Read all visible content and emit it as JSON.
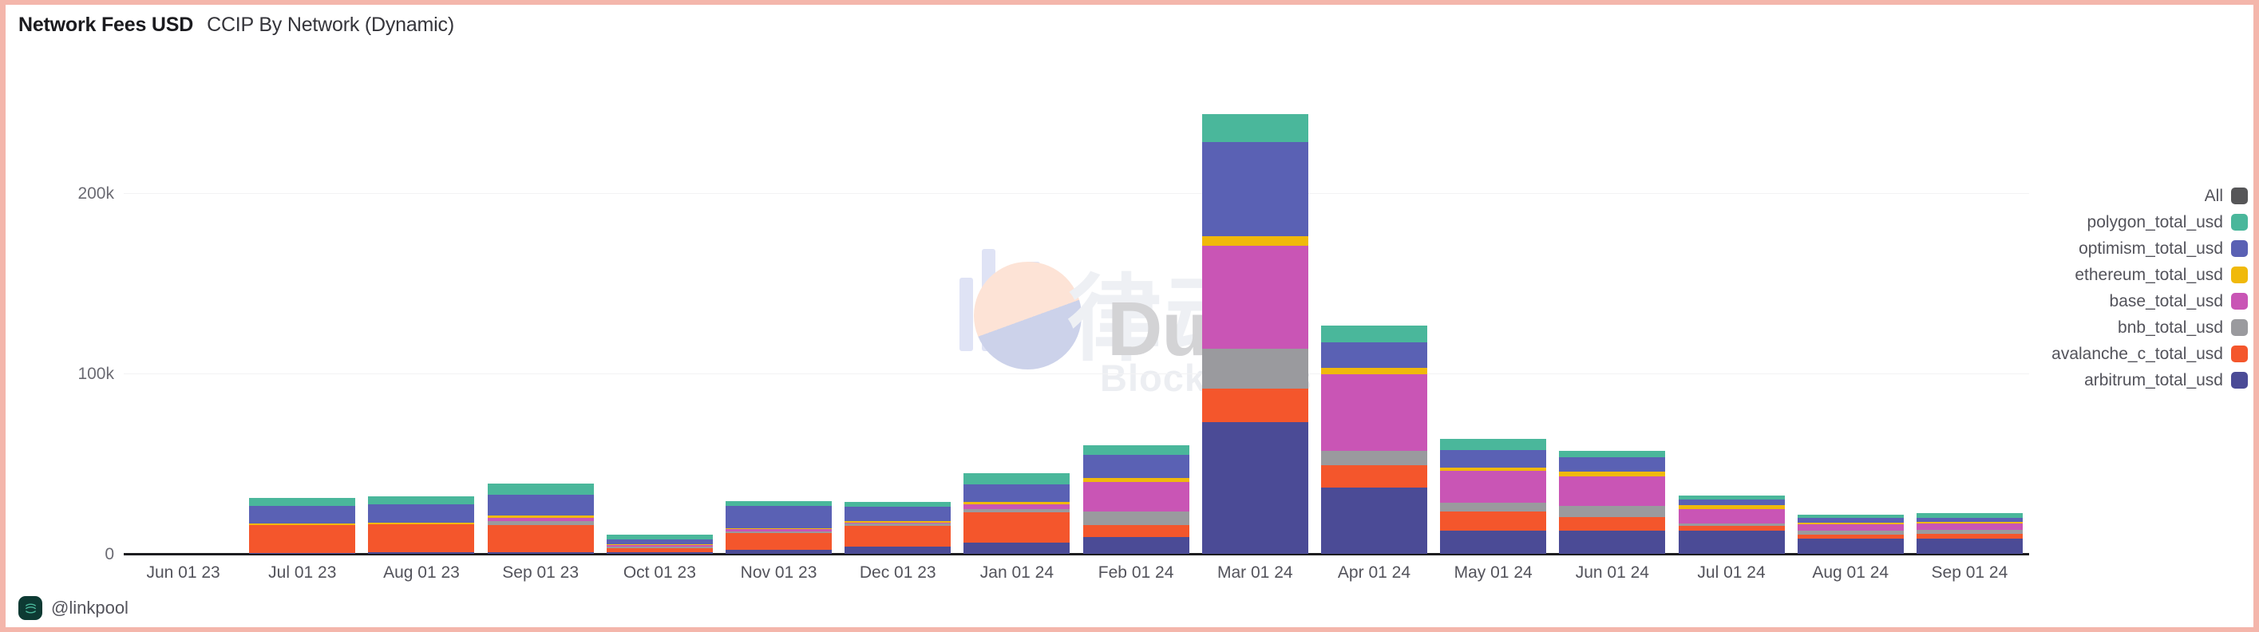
{
  "header": {
    "title": "Network Fees USD",
    "subtitle": "CCIP By Network (Dynamic)"
  },
  "footer": {
    "handle": "@linkpool",
    "icon": "linkpool-logo-icon"
  },
  "watermark": {
    "brand": "Dune",
    "cn_text": "律动",
    "sub_text": "BlockBeats"
  },
  "legend": {
    "position": "right",
    "items": [
      {
        "label": "All",
        "color": "#565658"
      },
      {
        "label": "polygon_total_usd",
        "color": "#4ab79b"
      },
      {
        "label": "optimism_total_usd",
        "color": "#5a61b4"
      },
      {
        "label": "ethereum_total_usd",
        "color": "#f0b90b"
      },
      {
        "label": "base_total_usd",
        "color": "#c955b5"
      },
      {
        "label": "bnb_total_usd",
        "color": "#9a9a9e"
      },
      {
        "label": "avalanche_c_total_usd",
        "color": "#f4562c"
      },
      {
        "label": "arbitrum_total_usd",
        "color": "#4b4b96"
      }
    ]
  },
  "chart_data": {
    "type": "bar",
    "stacked": true,
    "title": "Network Fees USD",
    "subtitle": "CCIP By Network (Dynamic)",
    "xlabel": "",
    "ylabel": "",
    "ylim": [
      0,
      260000
    ],
    "yticks": [
      0,
      100000,
      200000
    ],
    "ytick_labels": [
      "0",
      "100k",
      "200k"
    ],
    "grid": true,
    "categories": [
      "Jun 01 23",
      "Jul 01 23",
      "Aug 01 23",
      "Sep 01 23",
      "Oct 01 23",
      "Nov 01 23",
      "Dec 01 23",
      "Jan 01 24",
      "Feb 01 24",
      "Mar 01 24",
      "Apr 01 24",
      "May 01 24",
      "Jun 01 24",
      "Jul 01 24",
      "Aug 01 24",
      "Sep 01 24"
    ],
    "series": [
      {
        "name": "arbitrum_total_usd",
        "color": "#4b4b96",
        "values": [
          0,
          600,
          900,
          1100,
          700,
          2100,
          4000,
          6100,
          9500,
          73000,
          36500,
          13000,
          13000,
          13000,
          8500,
          8500
        ]
      },
      {
        "name": "avalanche_c_total_usd",
        "color": "#f4562c",
        "values": [
          0,
          15500,
          15500,
          15000,
          2500,
          9500,
          11500,
          17000,
          6500,
          18500,
          12500,
          10500,
          7500,
          2500,
          2000,
          2500
        ]
      },
      {
        "name": "bnb_total_usd",
        "color": "#9a9a9e",
        "values": [
          0,
          0,
          0,
          2000,
          900,
          700,
          1200,
          1700,
          7500,
          22000,
          8000,
          5000,
          6000,
          1500,
          2500,
          2500
        ]
      },
      {
        "name": "base_total_usd",
        "color": "#c955b5",
        "values": [
          0,
          0,
          0,
          1800,
          900,
          1300,
          700,
          2500,
          16500,
          57000,
          42500,
          17500,
          16500,
          8000,
          3500,
          3500
        ]
      },
      {
        "name": "ethereum_total_usd",
        "color": "#f0b90b",
        "values": [
          0,
          900,
          900,
          1200,
          200,
          600,
          700,
          1600,
          2000,
          5500,
          3500,
          2000,
          2500,
          1800,
          900,
          900
        ]
      },
      {
        "name": "optimism_total_usd",
        "color": "#5a61b4",
        "values": [
          0,
          9500,
          10000,
          11500,
          2500,
          12500,
          8000,
          9500,
          13000,
          52000,
          14000,
          9500,
          8000,
          3500,
          2500,
          2000
        ]
      },
      {
        "name": "polygon_total_usd",
        "color": "#4ab79b",
        "values": [
          0,
          4500,
          4500,
          6500,
          2500,
          2500,
          2500,
          6500,
          5000,
          15500,
          9500,
          6000,
          3500,
          2000,
          2000,
          2500
        ]
      }
    ]
  }
}
